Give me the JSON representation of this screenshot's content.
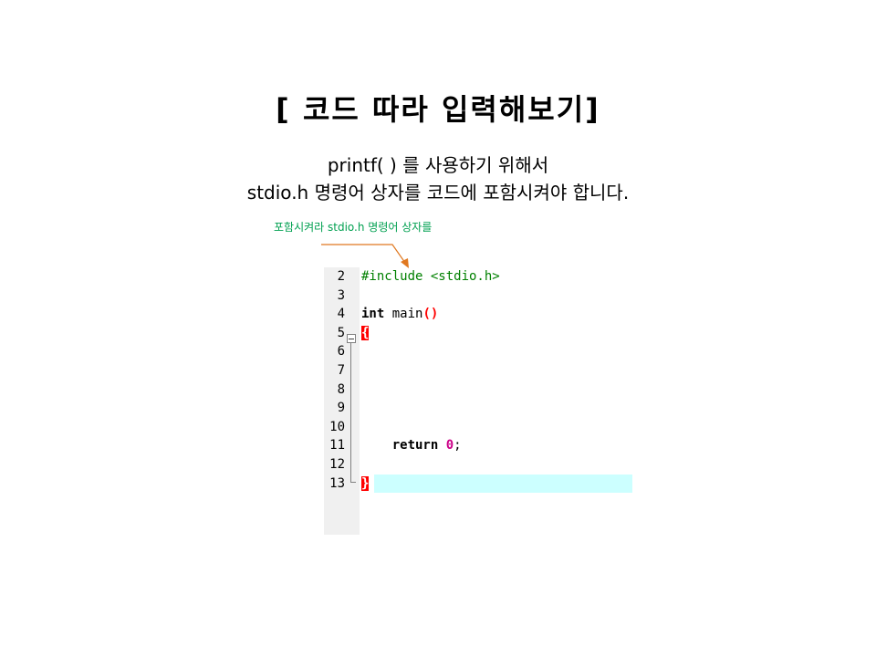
{
  "slide": {
    "title": "[ 코드 따라 입력해보기]",
    "subtitle_line1": "printf( ) 를 사용하기 위해서",
    "subtitle_line2": "stdio.h 명령어 상자를 코드에 포함시켜야 합니다.",
    "annotation": "포함시켜라 stdio.h 명령어 상자를"
  },
  "colors": {
    "annotation": "#00a050",
    "arrow": "#e07820",
    "current_line": "#ccffff",
    "brace_highlight": "#ff0000",
    "gutter": "#f0f0f0"
  },
  "editor": {
    "lines": [
      {
        "num": "2",
        "pp": "#include <stdio.h>"
      },
      {
        "num": "3"
      },
      {
        "num": "4",
        "kw": "int",
        "text": " main",
        "paren": "()"
      },
      {
        "num": "5",
        "brace": "{"
      },
      {
        "num": "6"
      },
      {
        "num": "7"
      },
      {
        "num": "8"
      },
      {
        "num": "9"
      },
      {
        "num": "10"
      },
      {
        "num": "11",
        "indent": "    ",
        "kw": "return",
        "text": " ",
        "number": "0",
        "tail": ";"
      },
      {
        "num": "12"
      },
      {
        "num": "13",
        "brace": "}",
        "current": true
      }
    ]
  }
}
